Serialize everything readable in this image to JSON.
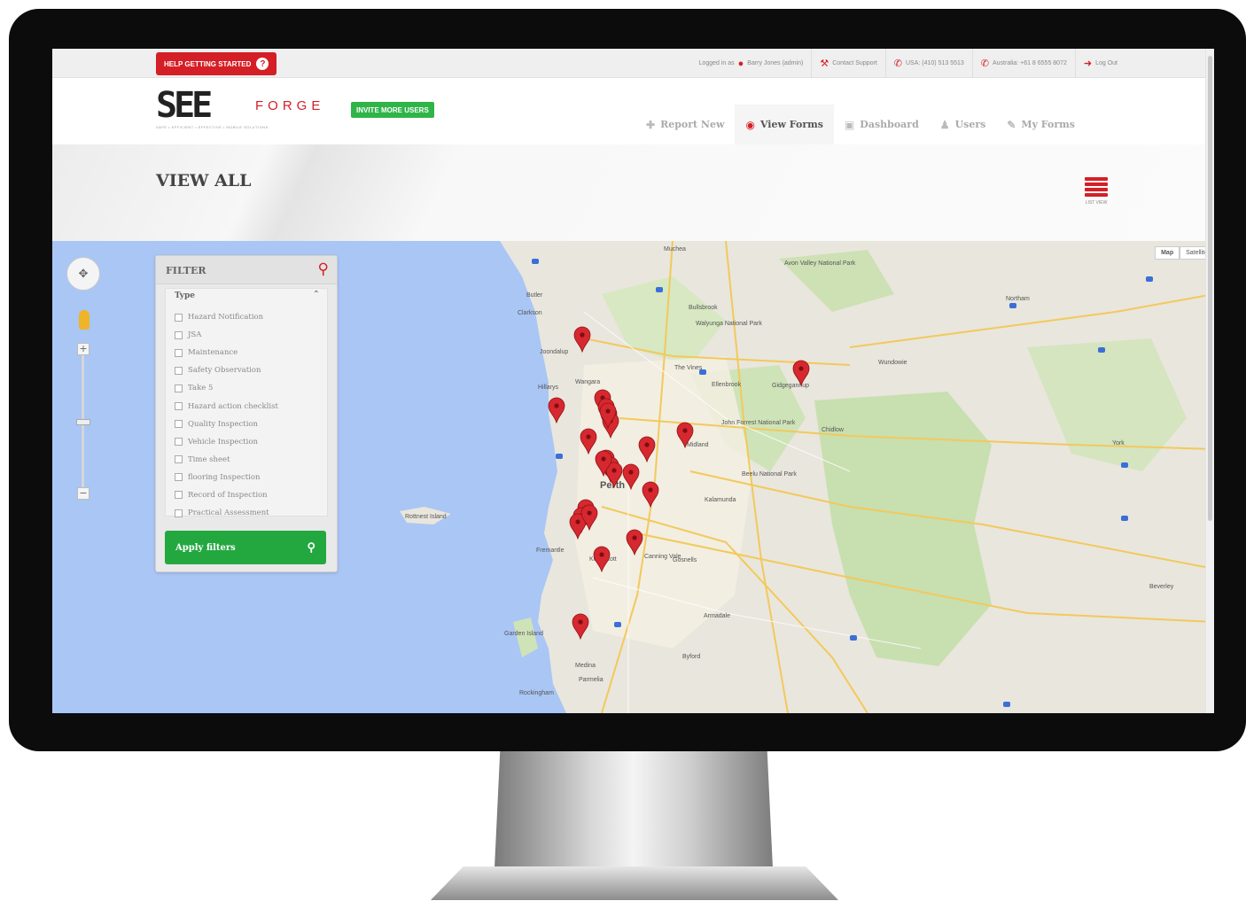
{
  "topbar": {
    "help_label": "HELP GETTING STARTED",
    "help_icon": "question-circle-icon",
    "logged_in_prefix": "Logged in as",
    "user_name": "Barry Jones (admin)",
    "contact_support": "Contact Support",
    "phone_usa": "USA: (410) 513 5513",
    "phone_australia": "Australia: +61 8 6555 8072",
    "logout": "Log Out"
  },
  "header": {
    "logo_see": "SEE",
    "logo_forge": "FORGE",
    "logo_tagline": "SAFE • EFFICIENT • EFFECTIVE • MOBILE SOLUTIONS",
    "invite_label": "INVITE MORE USERS"
  },
  "nav": {
    "tabs": [
      {
        "label": "Report New",
        "icon": "plus-icon"
      },
      {
        "label": "View Forms",
        "icon": "eye-icon"
      },
      {
        "label": "Dashboard",
        "icon": "dashboard-icon"
      },
      {
        "label": "Users",
        "icon": "users-icon"
      },
      {
        "label": "My Forms",
        "icon": "edit-icon"
      }
    ],
    "active": "View Forms"
  },
  "page": {
    "title": "VIEW ALL",
    "list_view_label": "LIST VIEW"
  },
  "filter": {
    "title": "FILTER",
    "type_heading": "Type",
    "options": [
      "Hazard Notification",
      "JSA",
      "Maintenance",
      "Safety Observation",
      "Take 5",
      "Hazard action checklist",
      "Quality Inspection",
      "Vehicle Inspection",
      "Time sheet",
      "flooring Inspection",
      "Record of Inspection",
      "Practical Assessment"
    ],
    "apply_label": "Apply filters"
  },
  "map": {
    "type_buttons": [
      "Map",
      "Satellite"
    ],
    "place_labels": [
      "Muchea",
      "Avon Valley National Park",
      "Bullsbrook",
      "Walyunga National Park",
      "Clarkson",
      "Butler",
      "Joondalup",
      "Hillarys",
      "Wangara",
      "The Vines",
      "Ellenbrook",
      "Gidgegannup",
      "Wundowie",
      "Northam",
      "Midland",
      "John Forrest National Park",
      "Chidlow",
      "Perth",
      "Kalamunda",
      "Beelu National Park",
      "York",
      "Rottnest Island",
      "Fremantle",
      "Canning Vale",
      "Gosnells",
      "Kelmscott",
      "Armadale",
      "Garden Island",
      "Medina",
      "Parmelia",
      "Byford",
      "Rockingham",
      "Beverley"
    ],
    "pin_color": "#d7282f",
    "pin_count": 24
  },
  "colors": {
    "brand_red": "#d41f26",
    "accent_green": "#23a840",
    "water": "#a9c6f5"
  }
}
